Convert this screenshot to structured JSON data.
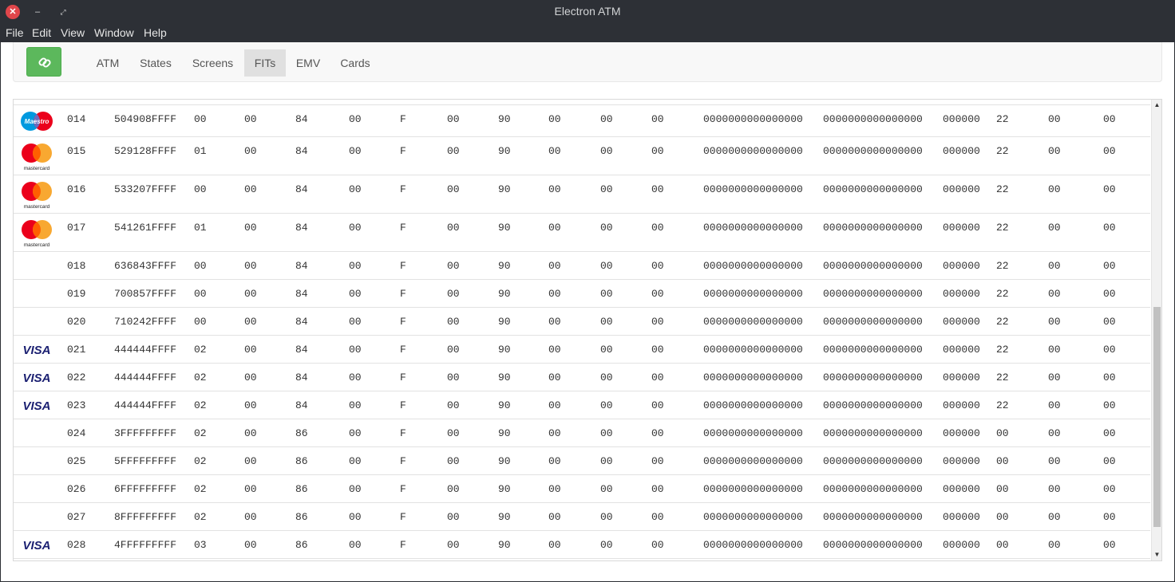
{
  "window": {
    "title": "Electron ATM",
    "close_glyph": "✕",
    "min_glyph": "–",
    "max_glyph": "⤢"
  },
  "menu": [
    "File",
    "Edit",
    "View",
    "Window",
    "Help"
  ],
  "navbar": {
    "connect_icon": "link-icon",
    "tabs": [
      "ATM",
      "States",
      "Screens",
      "FITs",
      "EMV",
      "Cards"
    ],
    "active_tab": "FITs"
  },
  "colors": {
    "connect_button": "#5cb85c",
    "active_tab": "#e0e0e0",
    "visa": "#1a1f71",
    "mastercard_red": "#eb001b",
    "mastercard_orange": "#f79e1b",
    "maestro_blue": "#0099df"
  },
  "brand_labels": {
    "maestro": "Maestro",
    "mastercard": "mastercard",
    "visa": "VISA"
  },
  "fits": [
    {
      "logo": "maestro",
      "cols": [
        "014",
        "504908FFFF",
        "00",
        "00",
        "84",
        "00",
        "F",
        "00",
        "90",
        "00",
        "00",
        "00",
        "0000000000000000",
        "0000000000000000",
        "000000",
        "22",
        "00",
        "00"
      ]
    },
    {
      "logo": "mastercard",
      "cols": [
        "015",
        "529128FFFF",
        "01",
        "00",
        "84",
        "00",
        "F",
        "00",
        "90",
        "00",
        "00",
        "00",
        "0000000000000000",
        "0000000000000000",
        "000000",
        "22",
        "00",
        "00"
      ]
    },
    {
      "logo": "mastercard",
      "cols": [
        "016",
        "533207FFFF",
        "00",
        "00",
        "84",
        "00",
        "F",
        "00",
        "90",
        "00",
        "00",
        "00",
        "0000000000000000",
        "0000000000000000",
        "000000",
        "22",
        "00",
        "00"
      ]
    },
    {
      "logo": "mastercard",
      "cols": [
        "017",
        "541261FFFF",
        "01",
        "00",
        "84",
        "00",
        "F",
        "00",
        "90",
        "00",
        "00",
        "00",
        "0000000000000000",
        "0000000000000000",
        "000000",
        "22",
        "00",
        "00"
      ]
    },
    {
      "logo": "",
      "cols": [
        "018",
        "636843FFFF",
        "00",
        "00",
        "84",
        "00",
        "F",
        "00",
        "90",
        "00",
        "00",
        "00",
        "0000000000000000",
        "0000000000000000",
        "000000",
        "22",
        "00",
        "00"
      ]
    },
    {
      "logo": "",
      "cols": [
        "019",
        "700857FFFF",
        "00",
        "00",
        "84",
        "00",
        "F",
        "00",
        "90",
        "00",
        "00",
        "00",
        "0000000000000000",
        "0000000000000000",
        "000000",
        "22",
        "00",
        "00"
      ]
    },
    {
      "logo": "",
      "cols": [
        "020",
        "710242FFFF",
        "00",
        "00",
        "84",
        "00",
        "F",
        "00",
        "90",
        "00",
        "00",
        "00",
        "0000000000000000",
        "0000000000000000",
        "000000",
        "22",
        "00",
        "00"
      ]
    },
    {
      "logo": "visa",
      "cols": [
        "021",
        "444444FFFF",
        "02",
        "00",
        "84",
        "00",
        "F",
        "00",
        "90",
        "00",
        "00",
        "00",
        "0000000000000000",
        "0000000000000000",
        "000000",
        "22",
        "00",
        "00"
      ]
    },
    {
      "logo": "visa",
      "cols": [
        "022",
        "444444FFFF",
        "02",
        "00",
        "84",
        "00",
        "F",
        "00",
        "90",
        "00",
        "00",
        "00",
        "0000000000000000",
        "0000000000000000",
        "000000",
        "22",
        "00",
        "00"
      ]
    },
    {
      "logo": "visa",
      "cols": [
        "023",
        "444444FFFF",
        "02",
        "00",
        "84",
        "00",
        "F",
        "00",
        "90",
        "00",
        "00",
        "00",
        "0000000000000000",
        "0000000000000000",
        "000000",
        "22",
        "00",
        "00"
      ]
    },
    {
      "logo": "",
      "cols": [
        "024",
        "3FFFFFFFFF",
        "02",
        "00",
        "86",
        "00",
        "F",
        "00",
        "90",
        "00",
        "00",
        "00",
        "0000000000000000",
        "0000000000000000",
        "000000",
        "00",
        "00",
        "00"
      ]
    },
    {
      "logo": "",
      "cols": [
        "025",
        "5FFFFFFFFF",
        "02",
        "00",
        "86",
        "00",
        "F",
        "00",
        "90",
        "00",
        "00",
        "00",
        "0000000000000000",
        "0000000000000000",
        "000000",
        "00",
        "00",
        "00"
      ]
    },
    {
      "logo": "",
      "cols": [
        "026",
        "6FFFFFFFFF",
        "02",
        "00",
        "86",
        "00",
        "F",
        "00",
        "90",
        "00",
        "00",
        "00",
        "0000000000000000",
        "0000000000000000",
        "000000",
        "00",
        "00",
        "00"
      ]
    },
    {
      "logo": "",
      "cols": [
        "027",
        "8FFFFFFFFF",
        "02",
        "00",
        "86",
        "00",
        "F",
        "00",
        "90",
        "00",
        "00",
        "00",
        "0000000000000000",
        "0000000000000000",
        "000000",
        "00",
        "00",
        "00"
      ]
    },
    {
      "logo": "visa",
      "cols": [
        "028",
        "4FFFFFFFFF",
        "03",
        "00",
        "86",
        "00",
        "F",
        "00",
        "90",
        "00",
        "00",
        "00",
        "0000000000000000",
        "0000000000000000",
        "000000",
        "00",
        "00",
        "00"
      ]
    }
  ],
  "scrollbar": {
    "up_glyph": "▲",
    "down_glyph": "▼"
  }
}
